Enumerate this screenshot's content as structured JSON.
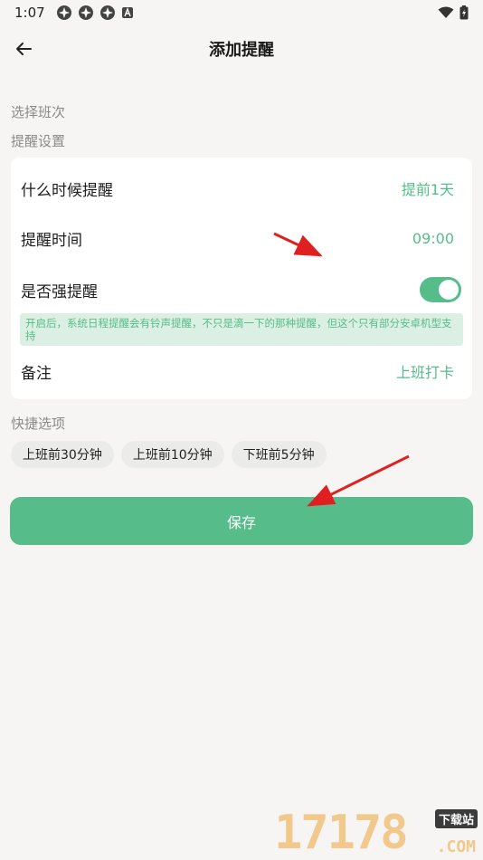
{
  "status_bar": {
    "time": "1:07"
  },
  "app_bar": {
    "title": "添加提醒"
  },
  "sections": {
    "choose_shift": "选择班次",
    "reminder_settings": "提醒设置",
    "quick_options": "快捷选项"
  },
  "settings": {
    "when": {
      "label": "什么时候提醒",
      "value": "提前1天"
    },
    "time": {
      "label": "提醒时间",
      "value": "09:00"
    },
    "strong": {
      "label": "是否强提醒",
      "enabled": true
    },
    "hint": "开启后，系统日程提醒会有铃声提醒，不只是滴一下的那种提醒，但这个只有部分安卓机型支持",
    "note": {
      "label": "备注",
      "value": "上班打卡"
    }
  },
  "quick_chips": [
    "上班前30分钟",
    "上班前10分钟",
    "下班前5分钟"
  ],
  "save_label": "保存",
  "watermark": {
    "digits": "17178",
    "site": "下载站",
    "suffix": ".COM"
  },
  "colors": {
    "accent": "#56bc8a",
    "hint_bg": "#dcefe3",
    "background": "#f6f5f3",
    "arrow": "#e02020"
  }
}
